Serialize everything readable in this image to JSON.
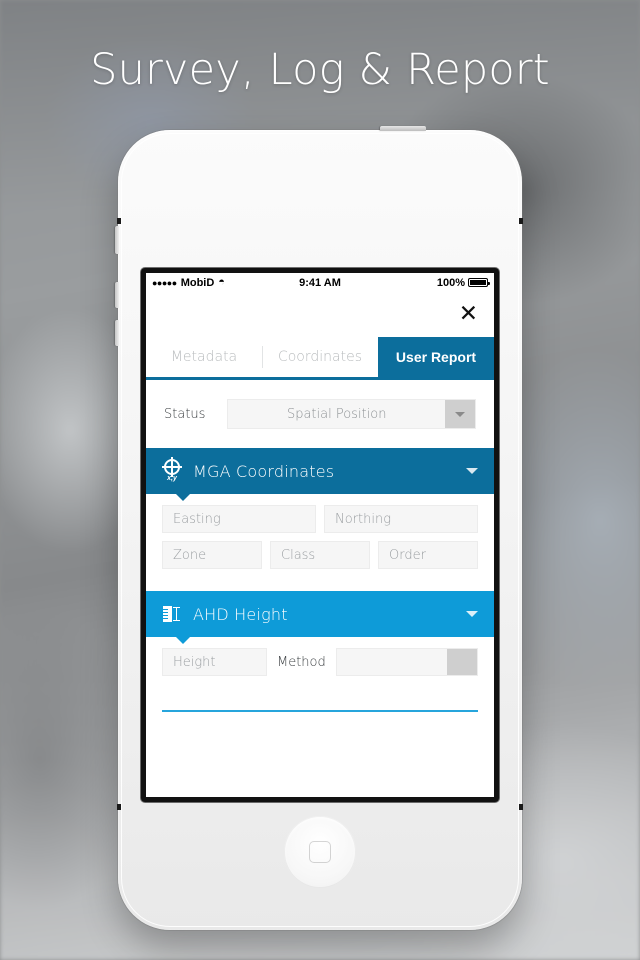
{
  "headline": "Survey, Log & Report",
  "statusbar": {
    "signal_dots": "●●●●●",
    "carrier": "MobiD",
    "wifi_icon": "wifi-icon",
    "time": "9:41 AM",
    "battery_percent": "100%"
  },
  "titlebar": {
    "close_label": "✕",
    "close_icon": "close-icon"
  },
  "tabs": [
    {
      "label": "Metadata",
      "active": false
    },
    {
      "label": "Coordinates",
      "active": false
    },
    {
      "label": "User Report",
      "active": true
    }
  ],
  "status_field": {
    "label": "Status",
    "value": "Spatial Position",
    "arrow_icon": "chevron-down-icon"
  },
  "sections": [
    {
      "id": "mga",
      "title": "MGA Coordinates",
      "icon": "crosshair-xy-icon",
      "icon_label": "x,y",
      "color": "#0c6e9c",
      "chevron_icon": "chevron-down-icon",
      "rows": [
        [
          {
            "name": "easting",
            "placeholder": "Easting",
            "value": ""
          },
          {
            "name": "northing",
            "placeholder": "Northing",
            "value": ""
          }
        ],
        [
          {
            "name": "zone",
            "placeholder": "Zone",
            "value": ""
          },
          {
            "name": "class",
            "placeholder": "Class",
            "value": ""
          },
          {
            "name": "order",
            "placeholder": "Order",
            "value": ""
          }
        ]
      ]
    },
    {
      "id": "ahd",
      "title": "AHD Height",
      "icon": "ruler-height-icon",
      "color": "#0e9bd8",
      "chevron_icon": "chevron-down-icon",
      "height_field": {
        "placeholder": "Height",
        "value": ""
      },
      "method_label": "Method",
      "method_value": "",
      "method_arrow_icon": "chevron-down-icon"
    }
  ],
  "colors": {
    "tab_active": "#0c6e9c",
    "section_dark": "#0c6e9c",
    "section_light": "#0e9bd8",
    "field_bg": "#f6f6f6",
    "placeholder_text": "#9a9ea1",
    "inactive_tab_text": "#b9bcbe"
  }
}
